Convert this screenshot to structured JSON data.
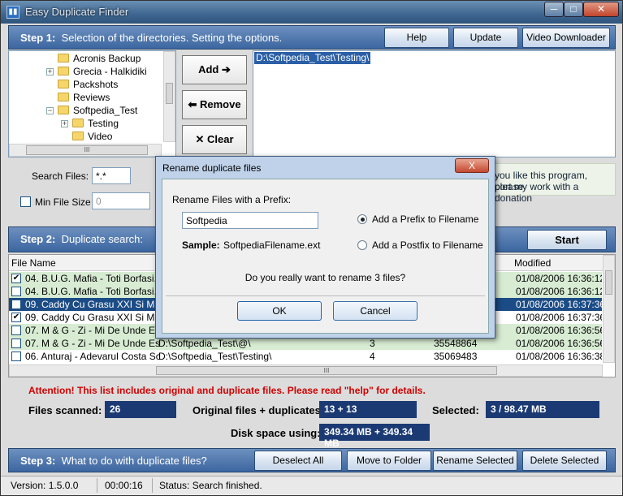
{
  "window": {
    "title": "Easy Duplicate Finder"
  },
  "step1": {
    "label_prefix": "Step 1:",
    "label_text": "Selection of the directories. Setting the options.",
    "help": "Help",
    "update": "Update",
    "video_downloader": "Video Downloader"
  },
  "tree": {
    "items": [
      "Acronis Backup",
      "Grecia - Halkidiki",
      "Packshots",
      "Reviews",
      "Softpedia_Test",
      "Testing",
      "Video"
    ],
    "hscroll_grip": "III"
  },
  "actions": {
    "add": "Add",
    "remove": "Remove",
    "clear": "Clear"
  },
  "selected_dirs": [
    "D:\\Softpedia_Test\\Testing\\"
  ],
  "options": {
    "search_files_label": "Search Files:",
    "search_files_value": "*.*",
    "min_size_label": "Min File Size",
    "min_size_value": "0"
  },
  "donate": {
    "line1": "you like this program, please",
    "line2": "port my work with a donation"
  },
  "step2": {
    "label_prefix": "Step 2:",
    "label_text": "Duplicate search:",
    "start": "Start"
  },
  "grid": {
    "col_filename": "File Name",
    "col_modified": "Modified",
    "rows": [
      {
        "checked": true,
        "name": "04. B.U.G. Mafia - Toti Borfasi.fl...",
        "path": "",
        "num": "",
        "size": "",
        "modified": "01/08/2006 16:36:12"
      },
      {
        "checked": false,
        "name": "04. B.U.G. Mafia - Toti Borfasi.fl...",
        "path": "",
        "num": "",
        "size": "",
        "modified": "01/08/2006 16:36:12"
      },
      {
        "checked": false,
        "name": "09. Caddy Cu Grasu XXI Si Mari...",
        "path": "",
        "num": "",
        "size": "",
        "modified": "01/08/2006 16:37:36"
      },
      {
        "checked": true,
        "name": "09. Caddy Cu Grasu XXI Si Mari...",
        "path": "",
        "num": "",
        "size": "",
        "modified": "01/08/2006 16:37:36"
      },
      {
        "checked": false,
        "name": "07. M & G - Zi - Mi De Unde Est...",
        "path": "",
        "num": "",
        "size": "",
        "modified": "01/08/2006 16:36:56"
      },
      {
        "checked": false,
        "name": "07. M & G - Zi - Mi De Unde Est...",
        "path": "D:\\Softpedia_Test\\@\\",
        "num": "3",
        "size": "35548864",
        "modified": "01/08/2006 16:36:56"
      },
      {
        "checked": false,
        "name": "06. Anturaj - Adevarul Costa Sc...",
        "path": "D:\\Softpedia_Test\\Testing\\",
        "num": "4",
        "size": "35069483",
        "modified": "01/08/2006 16:36:38"
      }
    ],
    "hscroll_grip": "III"
  },
  "info": {
    "attention": "Attention! This list includes original and duplicate files. Please read \"help\" for details.",
    "files_scanned_label": "Files scanned:",
    "files_scanned": "26",
    "orig_dup_label": "Original files + duplicates:",
    "orig_dup": "13 + 13",
    "selected_label": "Selected:",
    "selected": "3 / 98.47 MB",
    "disk_label": "Disk space using:",
    "disk": "349.34 MB + 349.34 MB"
  },
  "step3": {
    "label_prefix": "Step 3:",
    "label_text": "What to do with duplicate files?",
    "deselect_all": "Deselect All",
    "move_to_folder": "Move to Folder",
    "rename_selected": "Rename Selected",
    "delete_selected": "Delete Selected"
  },
  "status": {
    "version": "Version: 1.5.0.0",
    "time": "00:00:16",
    "message": "Status: Search finished."
  },
  "dialog": {
    "title": "Rename duplicate files",
    "close": "X",
    "prefix_label": "Rename Files with a Prefix:",
    "prefix_value": "Softpedia",
    "sample_label": "Sample:",
    "sample_value": "SoftpediaFilename.ext",
    "opt_prefix": "Add a Prefix to Filename",
    "opt_postfix": "Add a Postfix to Filename",
    "question": "Do you really want to rename 3 files?",
    "ok": "OK",
    "cancel": "Cancel"
  },
  "colors": {
    "step_bar": "#3c66a0",
    "info_value_bg": "#1b3a74",
    "attention": "#d00000",
    "row_green": "#d7ecd3",
    "row_selected": "#1c4c86"
  }
}
